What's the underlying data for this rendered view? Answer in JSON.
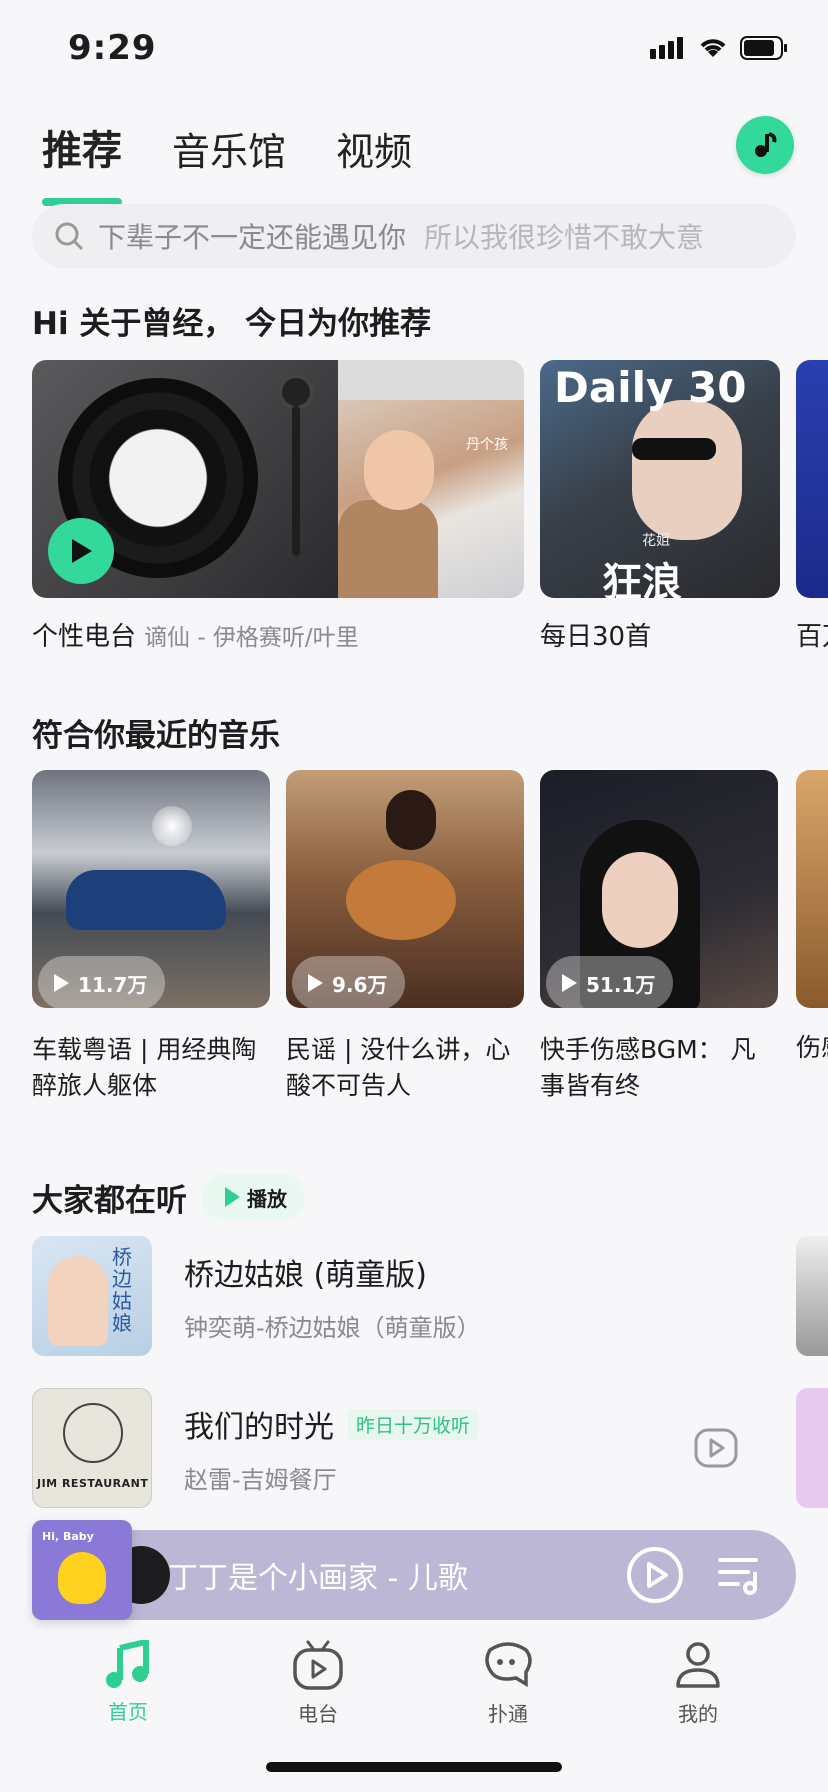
{
  "status": {
    "time": "9:29"
  },
  "tabs": [
    {
      "label": "推荐",
      "active": true
    },
    {
      "label": "音乐馆",
      "active": false
    },
    {
      "label": "视频",
      "active": false
    }
  ],
  "search": {
    "hint_primary": "下辈子不一定还能遇见你",
    "hint_secondary": "所以我很珍惜不敢大意"
  },
  "recommend": {
    "title": "Hi 关于曾经， 今日为你推荐",
    "radio": {
      "label": "个性电台",
      "sub": "谪仙 - 伊格赛听/叶里",
      "photo_tag": "丹个孩"
    },
    "daily": {
      "label": "每日30首",
      "cover_text": "Daily 30",
      "artist_text": "狂浪",
      "artist_small": "花姐"
    },
    "peek_label": "百万"
  },
  "recent": {
    "title": "符合你最近的音乐",
    "playlists": [
      {
        "count": "11.7万",
        "title": "车载粤语 | 用经典陶醉旅人躯体"
      },
      {
        "count": "9.6万",
        "title": "民谣 | 没什么讲，心酸不可告人"
      },
      {
        "count": "51.1万",
        "title": "快手伤感BGM： 凡事皆有终"
      }
    ],
    "peek_title": "伤感风，"
  },
  "listening": {
    "title": "大家都在听",
    "play_label": "播放",
    "songs": [
      {
        "name": "桥边姑娘 (萌童版)",
        "meta": "钟奕萌-桥边姑娘（萌童版）",
        "badge": "",
        "thumb_text": "桥边姑娘"
      },
      {
        "name": "我们的时光",
        "meta": "赵雷-吉姆餐厅",
        "badge": "昨日十万收听",
        "thumb_text": "JIM RESTAURANT"
      }
    ]
  },
  "player": {
    "now_playing": "丁丁是个小画家 - 儿歌",
    "art_text": "Hi, Baby"
  },
  "nav": [
    {
      "label": "首页",
      "active": true
    },
    {
      "label": "电台",
      "active": false
    },
    {
      "label": "扑通",
      "active": false
    },
    {
      "label": "我的",
      "active": false
    }
  ],
  "colors": {
    "accent": "#2fcf93",
    "player_bg": "#bdb7d6"
  }
}
